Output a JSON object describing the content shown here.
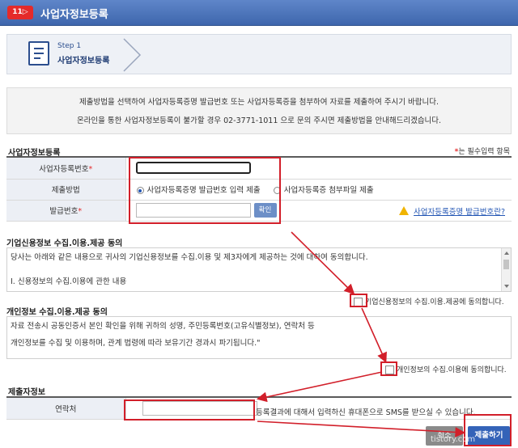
{
  "window": {
    "logo_text": "11▷",
    "title": "사업자정보등록"
  },
  "step": {
    "label": "Step 1",
    "name": "사업자정보등록"
  },
  "notice": {
    "line1": "제출방법을 선택하여 사업자등록증명 발급번호 또는 사업자등록증을 첨부하여 자료를 제출하여 주시기 바랍니다.",
    "line2": "온라인을 통한 사업자정보등록이 불가할 경우 02-3771-1011 으로 문의 주시면 제출방법을 안내해드리겠습니다."
  },
  "business_section": {
    "title": "사업자정보등록",
    "required_star": "*",
    "required_note": "는 필수입력 항목",
    "rows": {
      "bizno_label": "사업자등록번호",
      "bizno_value": "",
      "method_label": "제출방법",
      "method_option1": "사업자등록증명 발급번호 입력 제출",
      "method_option2": "사업자등록증 첨부파일 제출",
      "issue_label": "발급번호",
      "issue_value": "",
      "confirm_button": "확인",
      "help_link": "사업자등록증명 발급번호란?"
    }
  },
  "corp_consent": {
    "title": "기업신용정보 수집.이용.제공 동의",
    "text_line1": "당사는 아래와 같은 내용으로 귀사의 기업신용정보를 수집.이용 및 제3자에게 제공하는 것에 대하여 동의합니다.",
    "text_line2": "Ⅰ. 신용정보의 수집.이용에 관한 내용",
    "agree_label": "기업신용정보의 수집.이용.제공에 동의합니다."
  },
  "personal_consent": {
    "title": "개인정보 수집.이용.제공 동의",
    "text_line1": "자료 전송시 공동인증서 본인 확인을 위해 귀하의 성명, 주민등록번호(고유식별정보), 연락처 등",
    "text_line2": "개인정보를 수집 및 이용하며, 관계 법령에 따라 보유기간 경과시 파기됩니다.\"",
    "agree_label": "개인정보의 수집.이용에 동의합니다."
  },
  "submitter": {
    "title": "제출자정보",
    "contact_label": "연락처",
    "contact_value": "",
    "sms_note": "등록결과에 대해서 입력하신 휴대폰으로 SMS를 받으실 수 있습니다."
  },
  "buttons": {
    "cancel": "취소",
    "submit": "제출하기"
  },
  "watermark": "tistory.com",
  "colors": {
    "titlebar": "#4a72b8",
    "highlight": "#d21f2a",
    "accent": "#3463b8"
  }
}
